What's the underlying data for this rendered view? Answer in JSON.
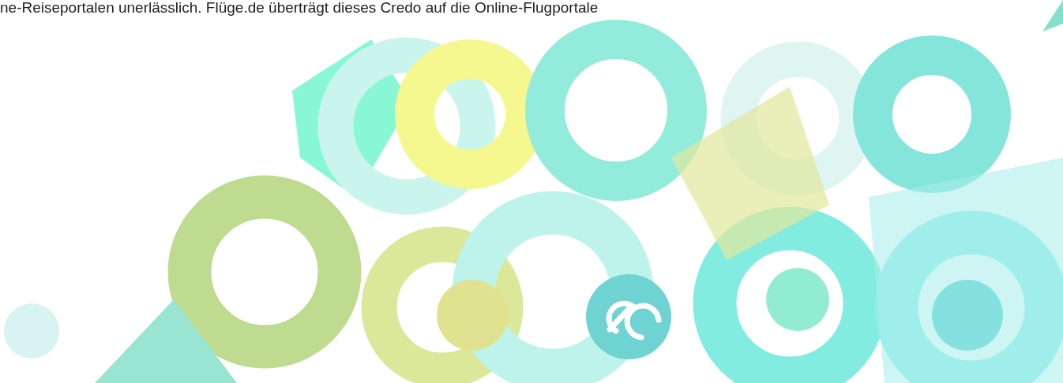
{
  "intro_text": "ne-Reiseportalen unerlässlich. Flüge.de überträgt dieses Credo auf die Online-Flugportale"
}
